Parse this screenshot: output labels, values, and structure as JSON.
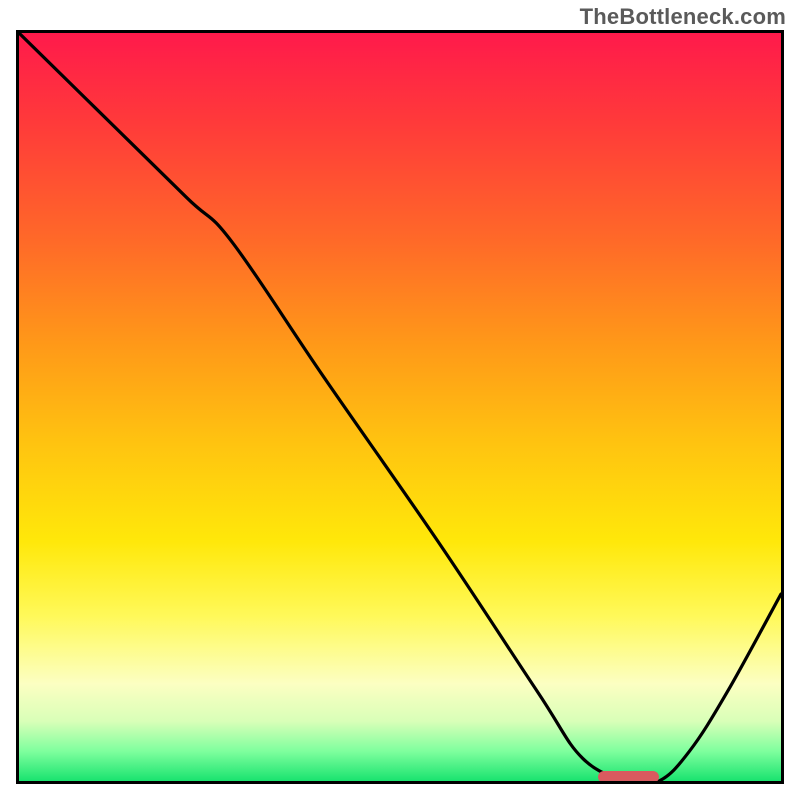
{
  "watermark": "TheBottleneck.com",
  "colors": {
    "border": "#000000",
    "curve": "#000000",
    "marker": "#d95a5f",
    "gradient_top": "#ff1a4b",
    "gradient_mid": "#ffe80a",
    "gradient_bottom": "#19e36f"
  },
  "chart_data": {
    "type": "line",
    "title": "",
    "xlabel": "",
    "ylabel": "",
    "xlim": [
      0,
      100
    ],
    "ylim": [
      0,
      100
    ],
    "grid": false,
    "series": [
      {
        "name": "bottleneck-curve",
        "x": [
          0,
          10,
          22,
          28,
          40,
          55,
          68,
          74,
          80,
          84,
          88,
          93,
          100
        ],
        "values": [
          100,
          90,
          78,
          72,
          54,
          32,
          12,
          3,
          0,
          0,
          4,
          12,
          25
        ]
      }
    ],
    "annotations": [
      {
        "name": "optimal-marker",
        "shape": "rounded-bar",
        "x_start": 76,
        "x_end": 84,
        "y": 0.5
      }
    ]
  }
}
